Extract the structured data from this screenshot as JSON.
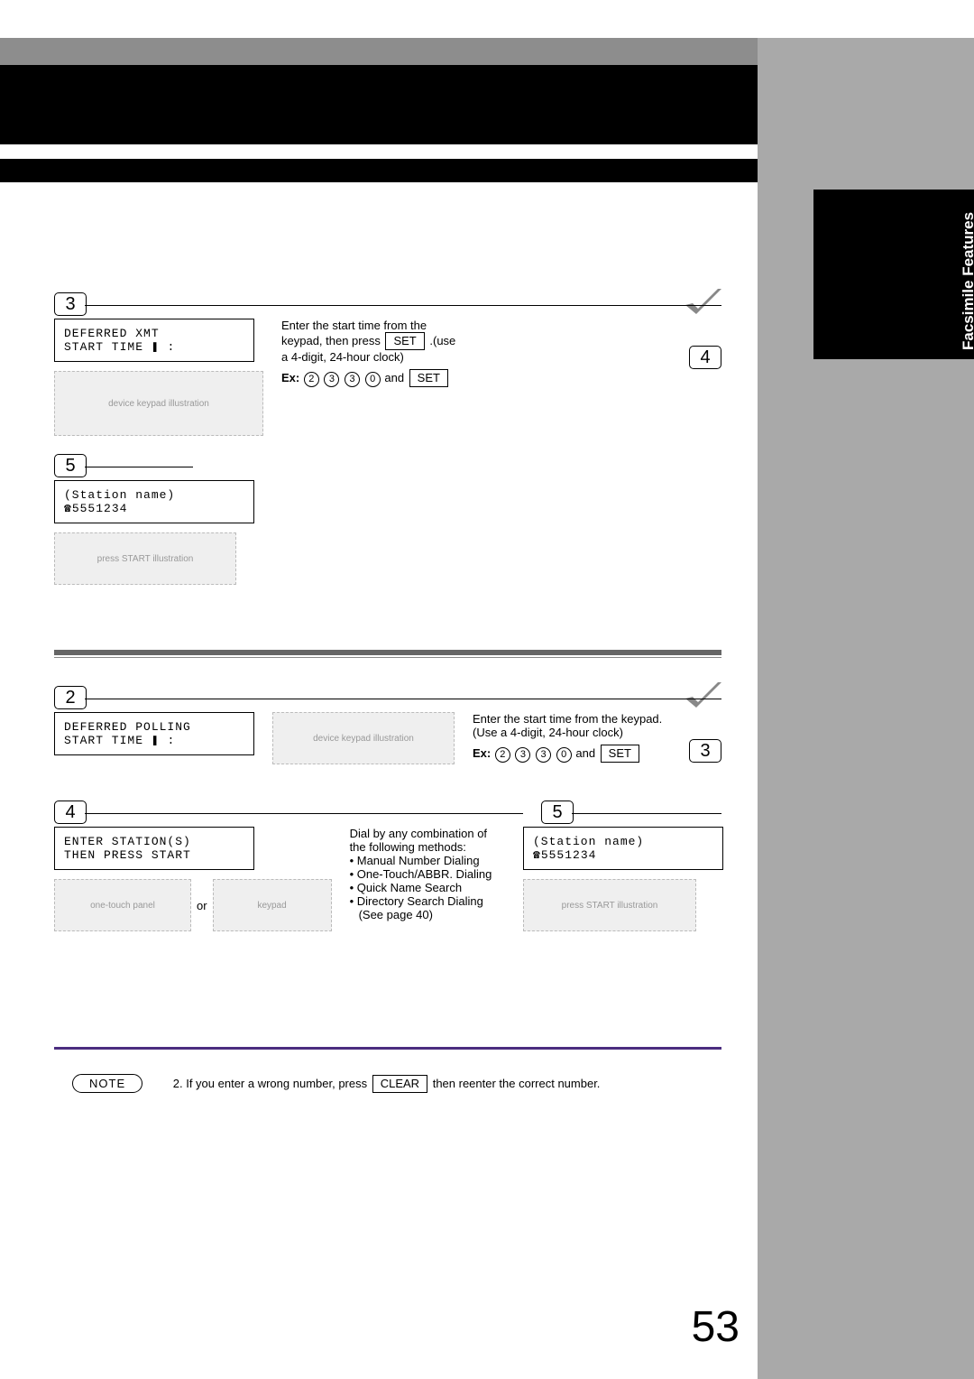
{
  "sideTab": "Facsimile Features",
  "pageNumber": "53",
  "sectionA": {
    "step3": "3",
    "lcd": {
      "l1": "DEFERRED XMT",
      "l2": "START TIME    ❚ :"
    },
    "txt1": "Enter the start time from the",
    "txt2": "keypad, then press ",
    "set1": "SET",
    "txt3": ".(use",
    "txt4": "a 4-digit, 24-hour clock)",
    "ex": "Ex:",
    "k1": "2",
    "k2": "3",
    "k3": "3",
    "k4": "0",
    "and": " and ",
    "set2": "SET",
    "step4": "4",
    "step5": "5",
    "lcd2": {
      "l1": "(Station name)",
      "l2": "☎5551234"
    }
  },
  "sectionB": {
    "step2": "2",
    "lcd": {
      "l1": "DEFERRED POLLING",
      "l2": "START TIME    ❚ :"
    },
    "txt1": "Enter the start time from the keypad.",
    "txt2": "(Use a 4-digit, 24-hour clock)",
    "ex": "Ex:",
    "k1": "2",
    "k2": "3",
    "k3": "3",
    "k4": "0",
    "and": " and ",
    "set": "SET",
    "step3": "3",
    "step4": "4",
    "step5": "5",
    "lcd2": {
      "l1": "ENTER STATION(S)",
      "l2": "THEN PRESS START"
    },
    "or": "or",
    "dial1": "Dial by any combination of the following methods:",
    "b1": "Manual Number Dialing",
    "b2": "One-Touch/ABBR. Dialing",
    "b3": "Quick Name Search",
    "b4": "Directory Search Dialing",
    "b5": "(See page 40)",
    "lcd3": {
      "l1": "(Station name)",
      "l2": "☎5551234"
    }
  },
  "note": {
    "label": "NOTE",
    "num": "2.",
    "t1": "If you enter a wrong number, press ",
    "clear": "CLEAR",
    "t2": " then reenter the correct number."
  }
}
